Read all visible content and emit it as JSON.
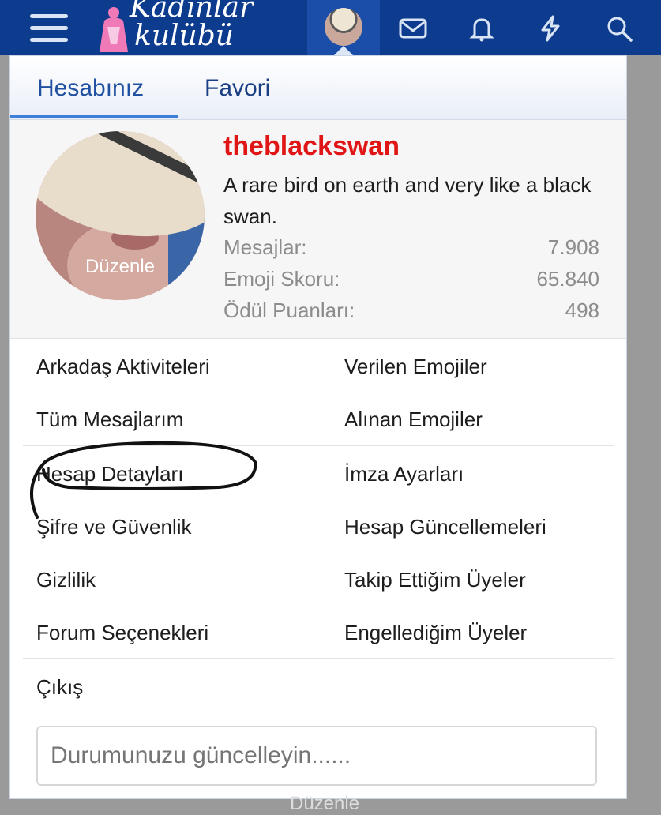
{
  "topbar": {
    "logo_line1": "Kadınlar",
    "logo_line2": "kulübü",
    "icons": [
      "menu-icon",
      "mail-icon",
      "bell-icon",
      "lightning-icon",
      "search-icon"
    ]
  },
  "tabs": {
    "active": "Hesabınız",
    "second": "Favori"
  },
  "profile": {
    "avatar_edit_label": "Düzenle",
    "username": "theblackswan",
    "bio": "A rare bird on earth and very like a black swan.",
    "stats": [
      {
        "label": "Mesajlar:",
        "value": "7.908"
      },
      {
        "label": "Emoji Skoru:",
        "value": "65.840"
      },
      {
        "label": "Ödül Puanları:",
        "value": "498"
      }
    ]
  },
  "menu": {
    "left": [
      "Arkadaş Aktiviteleri",
      "Tüm Mesajlarım",
      "Hesap Detayları",
      "Şifre ve Güvenlik",
      "Gizlilik",
      "Forum Seçenekleri"
    ],
    "right": [
      "Verilen Emojiler",
      "Alınan Emojiler",
      "İmza Ayarları",
      "Hesap Güncellemeleri",
      "Takip Ettiğim Üyeler",
      "Engellediğim Üyeler"
    ],
    "logout": "Çıkış"
  },
  "status": {
    "placeholder": "Durumunuzu güncelleyin......"
  },
  "background_label": "Düzenle",
  "colors": {
    "topbar": "#0d3b8e",
    "username": "#e01515",
    "tab_text": "#2050a0",
    "tab_underline": "#3d7fd6"
  }
}
